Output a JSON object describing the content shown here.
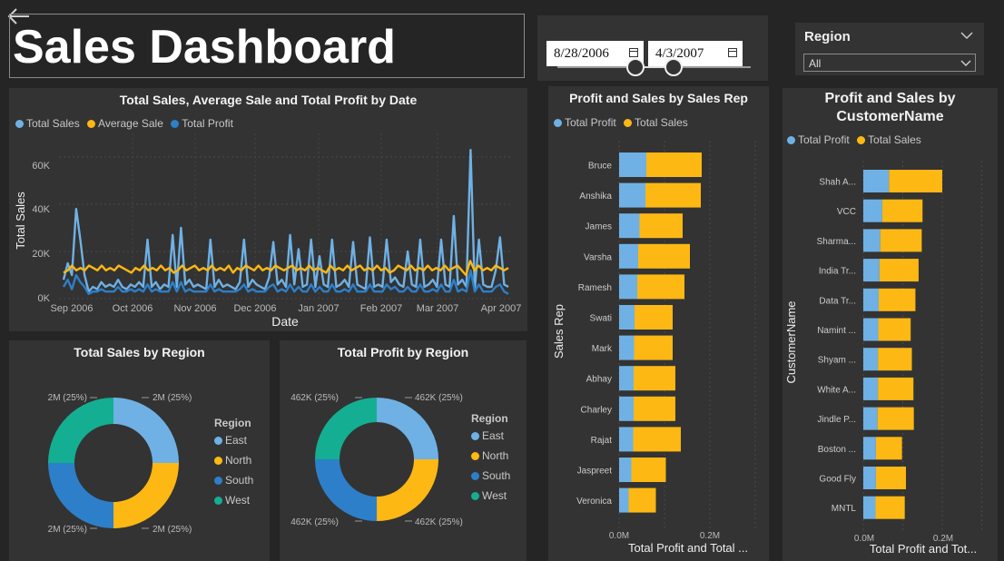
{
  "header": {
    "title": "Sales Dashboard",
    "back_icon": "arrow-left-icon"
  },
  "date_slicer": {
    "start": "8/28/2006",
    "end": "4/3/2007",
    "icon": "calendar-icon"
  },
  "region_slicer": {
    "label": "Region",
    "selected": "All"
  },
  "colors": {
    "light_blue": "#6fb1e4",
    "yellow": "#fdb813",
    "dark_blue": "#2d7fc9",
    "teal": "#14ae92",
    "panel": "#333333",
    "bg": "#252526"
  },
  "line_chart": {
    "title": "Total Sales, Average Sale and Total Profit by Date",
    "legend": [
      "Total Sales",
      "Average Sale",
      "Total Profit"
    ],
    "xlabel": "Date",
    "ylabel": "Total Sales",
    "yticks": [
      "0K",
      "20K",
      "40K",
      "60K"
    ],
    "xticks": [
      "Sep 2006",
      "Oct 2006",
      "Nov 2006",
      "Dec 2006",
      "Jan 2007",
      "Feb 2007",
      "Mar 2007",
      "Apr 2007"
    ]
  },
  "donut_sales": {
    "title": "Total Sales by Region",
    "legend_title": "Region",
    "labels": [
      "2M (25%)",
      "2M (25%)",
      "2M (25%)",
      "2M (25%)"
    ]
  },
  "donut_profit": {
    "title": "Total Profit by Region",
    "legend_title": "Region",
    "labels": [
      "462K (25%)",
      "462K (25%)",
      "462K (25%)",
      "462K (25%)"
    ]
  },
  "rep_chart": {
    "title": "Profit and Sales by Sales Rep",
    "legend": [
      "Total Profit",
      "Total Sales"
    ],
    "ylabel": "Sales Rep",
    "xlabel": "Total Profit and Total ...",
    "xticks": [
      "0.0M",
      "0.2M"
    ]
  },
  "cust_chart": {
    "title_line1": "Profit and Sales by",
    "title_line2": "CustomerName",
    "legend": [
      "Total Profit",
      "Total Sales"
    ],
    "ylabel": "CustomerName",
    "xlabel": "Total Profit and Tot...",
    "xticks": [
      "0.0M",
      "0.2M"
    ]
  },
  "chart_data": [
    {
      "type": "line",
      "title": "Total Sales, Average Sale and Total Profit by Date",
      "xlabel": "Date",
      "ylabel": "Total Sales",
      "ylim": [
        0,
        70000
      ],
      "x_start": "2006-08-28",
      "x_end": "2007-04-03",
      "series": [
        {
          "name": "Total Sales",
          "color": "#6fb1e4",
          "values": [
            8000,
            15000,
            10000,
            38000,
            25000,
            10000,
            3000,
            5000,
            4000,
            7000,
            5000,
            6000,
            5000,
            8000,
            5000,
            4000,
            6000,
            5000,
            7000,
            5000,
            25000,
            5000,
            7000,
            4000,
            6000,
            5000,
            27000,
            5000,
            30000,
            6000,
            8000,
            5000,
            6000,
            5000,
            4000,
            25000,
            5000,
            8000,
            5000,
            6000,
            5000,
            4000,
            7000,
            25000,
            5000,
            8000,
            6000,
            5000,
            4000,
            9000,
            24000,
            6000,
            8000,
            5000,
            27000,
            6000,
            21000,
            5000,
            6000,
            25000,
            5000,
            18000,
            6000,
            5000,
            25000,
            5000,
            6000,
            8000,
            5000,
            24000,
            6000,
            5000,
            4000,
            26000,
            5000,
            6000,
            5000,
            25000,
            7000,
            9000,
            6000,
            5000,
            20000,
            6000,
            5000,
            25000,
            5000,
            6000,
            8000,
            5000,
            25000,
            6000,
            5000,
            35000,
            6000,
            8000,
            5000,
            63000,
            4000,
            25000,
            6000,
            5000,
            5000,
            12000,
            26000,
            6000,
            5000
          ]
        },
        {
          "name": "Average Sale",
          "color": "#fdb813",
          "values": [
            11000,
            12000,
            14000,
            12000,
            13000,
            12000,
            14000,
            13000,
            12000,
            14000,
            12000,
            13000,
            12000,
            14000,
            13000,
            12000,
            11000,
            13000,
            12000,
            14000,
            12000,
            13000,
            12000,
            14000,
            12000,
            13000,
            11000,
            12000,
            14000,
            12000,
            13000,
            14000,
            12000,
            13000,
            12000,
            14000,
            12000,
            13000,
            12000,
            14000,
            11000,
            13000,
            12000,
            14000,
            13000,
            12000,
            14000,
            12000,
            13000,
            12000,
            14000,
            13000,
            12000,
            13000,
            14000,
            12000,
            13000,
            12000,
            14000,
            12000,
            13000,
            12000,
            11000,
            14000,
            12000,
            13000,
            12000,
            14000,
            12000,
            13000,
            14000,
            12000,
            13000,
            12000,
            14000,
            12000,
            13000,
            11000,
            12000,
            14000,
            13000,
            12000,
            14000,
            12000,
            13000,
            12000,
            14000,
            12000,
            13000,
            12000,
            14000,
            12000,
            13000,
            14000,
            12000,
            10000,
            16000,
            12000,
            14000,
            12000,
            13000,
            12000,
            14000,
            13000,
            12000,
            13000
          ]
        },
        {
          "name": "Total Profit",
          "color": "#2d7fc9",
          "values": [
            5000,
            8000,
            4000,
            10000,
            7000,
            5000,
            2000,
            3000,
            3000,
            4000,
            3000,
            3000,
            3000,
            5000,
            3000,
            3000,
            4000,
            3000,
            4000,
            3000,
            6000,
            3000,
            4000,
            3000,
            3000,
            3000,
            7000,
            3000,
            7000,
            3000,
            4000,
            3000,
            3000,
            3000,
            3000,
            6000,
            3000,
            4000,
            3000,
            3000,
            3000,
            3000,
            4000,
            6000,
            3000,
            4000,
            3000,
            3000,
            3000,
            5000,
            6000,
            3000,
            4000,
            3000,
            6000,
            3000,
            5000,
            3000,
            3000,
            6000,
            3000,
            5000,
            3000,
            3000,
            6000,
            3000,
            3000,
            4000,
            3000,
            6000,
            3000,
            3000,
            3000,
            6000,
            3000,
            3000,
            3000,
            6000,
            4000,
            5000,
            3000,
            3000,
            5000,
            3000,
            3000,
            6000,
            3000,
            3000,
            4000,
            3000,
            6000,
            3000,
            3000,
            8000,
            3000,
            4000,
            3000,
            12000,
            3000,
            6000,
            3000,
            3000,
            3000,
            5000,
            6000,
            3000,
            2000
          ]
        }
      ]
    },
    {
      "type": "pie",
      "title": "Total Sales by Region",
      "categories": [
        "East",
        "North",
        "South",
        "West"
      ],
      "values": [
        25,
        25,
        25,
        25
      ],
      "colors": [
        "#6fb1e4",
        "#fdb813",
        "#2d7fc9",
        "#14ae92"
      ]
    },
    {
      "type": "pie",
      "title": "Total Profit by Region",
      "categories": [
        "East",
        "North",
        "South",
        "West"
      ],
      "values": [
        25,
        25,
        25,
        25
      ],
      "colors": [
        "#6fb1e4",
        "#fdb813",
        "#2d7fc9",
        "#14ae92"
      ]
    },
    {
      "type": "bar",
      "title": "Profit and Sales by Sales Rep",
      "categories": [
        "Bruce",
        "Anshika",
        "James",
        "Varsha",
        "Ramesh",
        "Swati",
        "Mark",
        "Abhay",
        "Charley",
        "Rajat",
        "Jaspreet",
        "Veronica"
      ],
      "xlim": [
        0,
        0.31
      ],
      "series": [
        {
          "name": "Total Profit",
          "values": [
            0.06,
            0.058,
            0.045,
            0.042,
            0.04,
            0.034,
            0.033,
            0.032,
            0.032,
            0.031,
            0.027,
            0.021
          ]
        },
        {
          "name": "Total Sales",
          "values": [
            0.182,
            0.18,
            0.14,
            0.156,
            0.144,
            0.118,
            0.118,
            0.124,
            0.124,
            0.136,
            0.103,
            0.081
          ]
        }
      ]
    },
    {
      "type": "bar",
      "title": "Profit and Sales by CustomerName",
      "categories": [
        "Shah A...",
        "VCC",
        "Sharma...",
        "India Tr...",
        "Data Tr...",
        "Namint ...",
        "Shyam ...",
        "White A...",
        "Jindle P...",
        "Boston ...",
        "Good Fly",
        "MNTL"
      ],
      "xlim": [
        0,
        0.31
      ],
      "series": [
        {
          "name": "Total Profit",
          "values": [
            0.065,
            0.048,
            0.043,
            0.041,
            0.039,
            0.038,
            0.037,
            0.037,
            0.036,
            0.032,
            0.032,
            0.031
          ]
        },
        {
          "name": "Total Sales",
          "values": [
            0.2,
            0.15,
            0.148,
            0.14,
            0.132,
            0.12,
            0.123,
            0.127,
            0.128,
            0.098,
            0.108,
            0.105
          ]
        }
      ]
    }
  ]
}
